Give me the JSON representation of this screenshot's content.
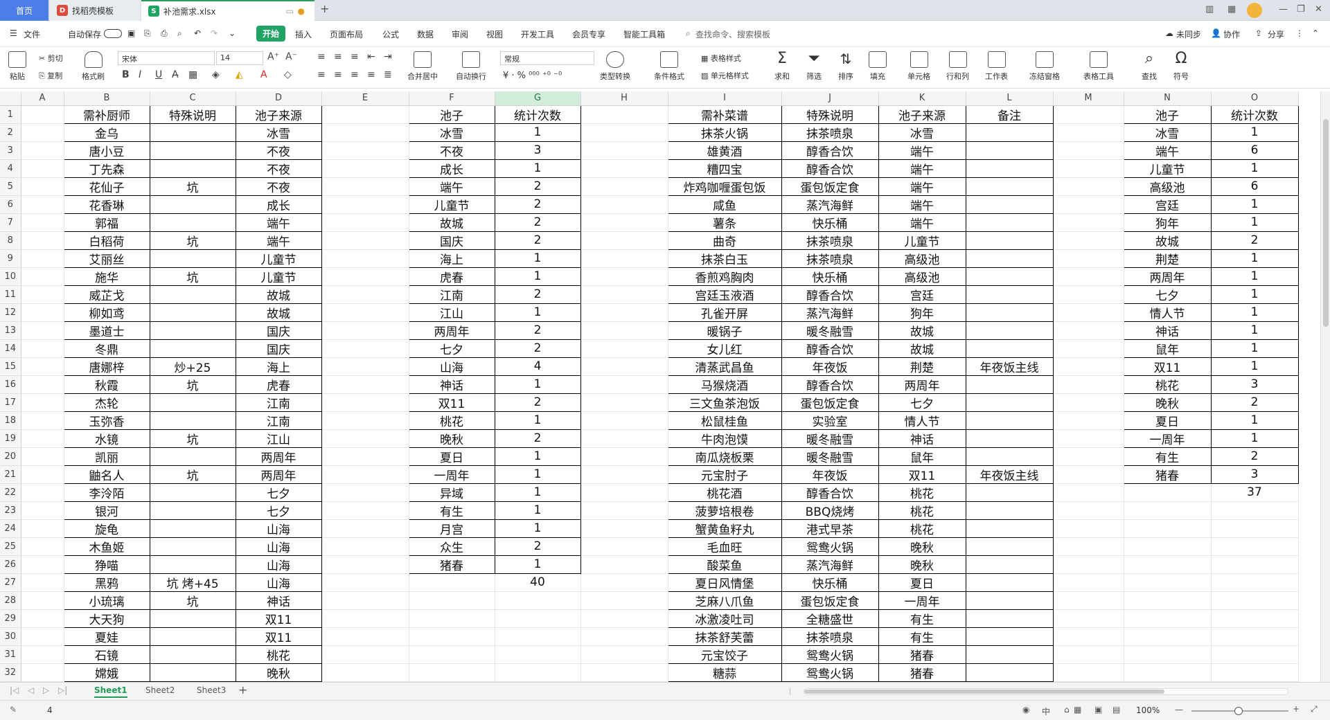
{
  "tabs": {
    "home": "首页",
    "template": "找稻壳模板",
    "file": "补池需求.xlsx"
  },
  "menu": {
    "file": "文件",
    "autosave": "自动保存",
    "start": "开始",
    "items": [
      "插入",
      "页面布局",
      "公式",
      "数据",
      "审阅",
      "视图",
      "开发工具",
      "会员专享",
      "智能工具箱"
    ],
    "search": "查找命令、搜索模板",
    "sync": "未同步",
    "collab": "协作",
    "share": "分享"
  },
  "ribbon": {
    "paste": "粘贴",
    "cut": "剪切",
    "copy": "复制",
    "format_painter": "格式刷",
    "font": "宋体",
    "size": "14",
    "number_format": "常规",
    "merge": "合并居中",
    "wrap": "自动换行",
    "type_convert": "类型转换",
    "cond_format": "条件格式",
    "table_style": "表格样式",
    "cell_style": "单元格样式",
    "sum": "求和",
    "filter": "筛选",
    "sort": "排序",
    "fill": "填充",
    "cell": "单元格",
    "rowcol": "行和列",
    "worksheet": "工作表",
    "freeze": "冻结窗格",
    "table_tools": "表格工具",
    "find": "查找",
    "symbol": "符号"
  },
  "cols": [
    "A",
    "B",
    "C",
    "D",
    "E",
    "F",
    "G",
    "H",
    "I",
    "J",
    "K",
    "L",
    "M",
    "N",
    "O"
  ],
  "headers": {
    "b": "需补厨师",
    "c": "特殊说明",
    "d": "池子来源",
    "f": "池子",
    "g": "统计次数",
    "i": "需补菜谱",
    "j": "特殊说明",
    "k": "池子来源",
    "l": "备注",
    "n": "池子",
    "o": "统计次数"
  },
  "chefs": [
    [
      "金乌",
      "",
      "冰雪"
    ],
    [
      "唐小豆",
      "",
      "不夜"
    ],
    [
      "丁先森",
      "",
      "不夜"
    ],
    [
      "花仙子",
      "坑",
      "不夜"
    ],
    [
      "花香琳",
      "",
      "成长"
    ],
    [
      "郭福",
      "",
      "端午"
    ],
    [
      "白稻荷",
      "坑",
      "端午"
    ],
    [
      "艾丽丝",
      "",
      "儿童节"
    ],
    [
      "施华",
      "坑",
      "儿童节"
    ],
    [
      "威芷戈",
      "",
      "故城"
    ],
    [
      "柳如鸢",
      "",
      "故城"
    ],
    [
      "墨道士",
      "",
      "国庆"
    ],
    [
      "冬鼎",
      "",
      "国庆"
    ],
    [
      "唐娜梓",
      "炒+25",
      "海上"
    ],
    [
      "秋霞",
      "坑",
      "虎春"
    ],
    [
      "杰轮",
      "",
      "江南"
    ],
    [
      "玉弥香",
      "",
      "江南"
    ],
    [
      "水镜",
      "坑",
      "江山"
    ],
    [
      "凯丽",
      "",
      "两周年"
    ],
    [
      "鼬名人",
      "坑",
      "两周年"
    ],
    [
      "李泠陌",
      "",
      "七夕"
    ],
    [
      "银河",
      "",
      "七夕"
    ],
    [
      "旋龟",
      "",
      "山海"
    ],
    [
      "木鱼姬",
      "",
      "山海"
    ],
    [
      "狰喵",
      "",
      "山海"
    ],
    [
      "黑鸦",
      "坑 烤+45",
      "山海"
    ],
    [
      "小琉璃",
      "坑",
      "神话"
    ],
    [
      "大天狗",
      "",
      "双11"
    ],
    [
      "夏娃",
      "",
      "双11"
    ],
    [
      "石镜",
      "",
      "桃花"
    ],
    [
      "嫦娥",
      "",
      "晚秋"
    ]
  ],
  "pool1": [
    [
      "冰雪",
      "1"
    ],
    [
      "不夜",
      "3"
    ],
    [
      "成长",
      "1"
    ],
    [
      "端午",
      "2"
    ],
    [
      "儿童节",
      "2"
    ],
    [
      "故城",
      "2"
    ],
    [
      "国庆",
      "2"
    ],
    [
      "海上",
      "1"
    ],
    [
      "虎春",
      "1"
    ],
    [
      "江南",
      "2"
    ],
    [
      "江山",
      "1"
    ],
    [
      "两周年",
      "2"
    ],
    [
      "七夕",
      "2"
    ],
    [
      "山海",
      "4"
    ],
    [
      "神话",
      "1"
    ],
    [
      "双11",
      "2"
    ],
    [
      "桃花",
      "1"
    ],
    [
      "晚秋",
      "2"
    ],
    [
      "夏日",
      "1"
    ],
    [
      "一周年",
      "1"
    ],
    [
      "异域",
      "1"
    ],
    [
      "有生",
      "1"
    ],
    [
      "月宫",
      "1"
    ],
    [
      "众生",
      "2"
    ],
    [
      "猪春",
      "1"
    ]
  ],
  "pool1_total": "40",
  "recipes": [
    [
      "抹茶火锅",
      "抹茶喷泉",
      "冰雪",
      ""
    ],
    [
      "雄黄酒",
      "醇香合饮",
      "端午",
      ""
    ],
    [
      "糟四宝",
      "醇香合饮",
      "端午",
      ""
    ],
    [
      "炸鸡咖喱蛋包饭",
      "蛋包饭定食",
      "端午",
      ""
    ],
    [
      "咸鱼",
      "蒸汽海鲜",
      "端午",
      ""
    ],
    [
      "薯条",
      "快乐桶",
      "端午",
      ""
    ],
    [
      "曲奇",
      "抹茶喷泉",
      "儿童节",
      ""
    ],
    [
      "抹茶白玉",
      "抹茶喷泉",
      "高级池",
      ""
    ],
    [
      "香煎鸡胸肉",
      "快乐桶",
      "高级池",
      ""
    ],
    [
      "宫廷玉液酒",
      "醇香合饮",
      "宫廷",
      ""
    ],
    [
      "孔雀开屏",
      "蒸汽海鲜",
      "狗年",
      ""
    ],
    [
      "暖锅子",
      "暖冬融雪",
      "故城",
      ""
    ],
    [
      "女儿红",
      "醇香合饮",
      "故城",
      ""
    ],
    [
      "清蒸武昌鱼",
      "年夜饭",
      "荆楚",
      "年夜饭主线"
    ],
    [
      "马猴烧酒",
      "醇香合饮",
      "两周年",
      ""
    ],
    [
      "三文鱼茶泡饭",
      "蛋包饭定食",
      "七夕",
      ""
    ],
    [
      "松鼠桂鱼",
      "实验室",
      "情人节",
      ""
    ],
    [
      "牛肉泡馍",
      "暖冬融雪",
      "神话",
      ""
    ],
    [
      "南瓜烧板栗",
      "暖冬融雪",
      "鼠年",
      ""
    ],
    [
      "元宝肘子",
      "年夜饭",
      "双11",
      "年夜饭主线"
    ],
    [
      "桃花酒",
      "醇香合饮",
      "桃花",
      ""
    ],
    [
      "菠萝培根卷",
      "BBQ烧烤",
      "桃花",
      ""
    ],
    [
      "蟹黄鱼籽丸",
      "港式早茶",
      "桃花",
      ""
    ],
    [
      "毛血旺",
      "鸳鸯火锅",
      "晚秋",
      ""
    ],
    [
      "酸菜鱼",
      "蒸汽海鲜",
      "晚秋",
      ""
    ],
    [
      "夏日风情堡",
      "快乐桶",
      "夏日",
      ""
    ],
    [
      "芝麻八爪鱼",
      "蛋包饭定食",
      "一周年",
      ""
    ],
    [
      "冰激凌吐司",
      "全糖盛世",
      "有生",
      ""
    ],
    [
      "抹茶舒芙蕾",
      "抹茶喷泉",
      "有生",
      ""
    ],
    [
      "元宝饺子",
      "鸳鸯火锅",
      "猪春",
      ""
    ],
    [
      "糖蒜",
      "鸳鸯火锅",
      "猪春",
      ""
    ]
  ],
  "pool2": [
    [
      "冰雪",
      "1"
    ],
    [
      "端午",
      "6"
    ],
    [
      "儿童节",
      "1"
    ],
    [
      "高级池",
      "6"
    ],
    [
      "宫廷",
      "1"
    ],
    [
      "狗年",
      "1"
    ],
    [
      "故城",
      "2"
    ],
    [
      "荆楚",
      "1"
    ],
    [
      "两周年",
      "1"
    ],
    [
      "七夕",
      "1"
    ],
    [
      "情人节",
      "1"
    ],
    [
      "神话",
      "1"
    ],
    [
      "鼠年",
      "1"
    ],
    [
      "双11",
      "1"
    ],
    [
      "桃花",
      "3"
    ],
    [
      "晚秋",
      "2"
    ],
    [
      "夏日",
      "1"
    ],
    [
      "一周年",
      "1"
    ],
    [
      "有生",
      "2"
    ],
    [
      "猪春",
      "3"
    ]
  ],
  "pool2_total": "37",
  "sheet_tabs": [
    "Sheet1",
    "Sheet2",
    "Sheet3"
  ],
  "status": {
    "count": "4",
    "zoom": "100%",
    "lang": "中"
  }
}
